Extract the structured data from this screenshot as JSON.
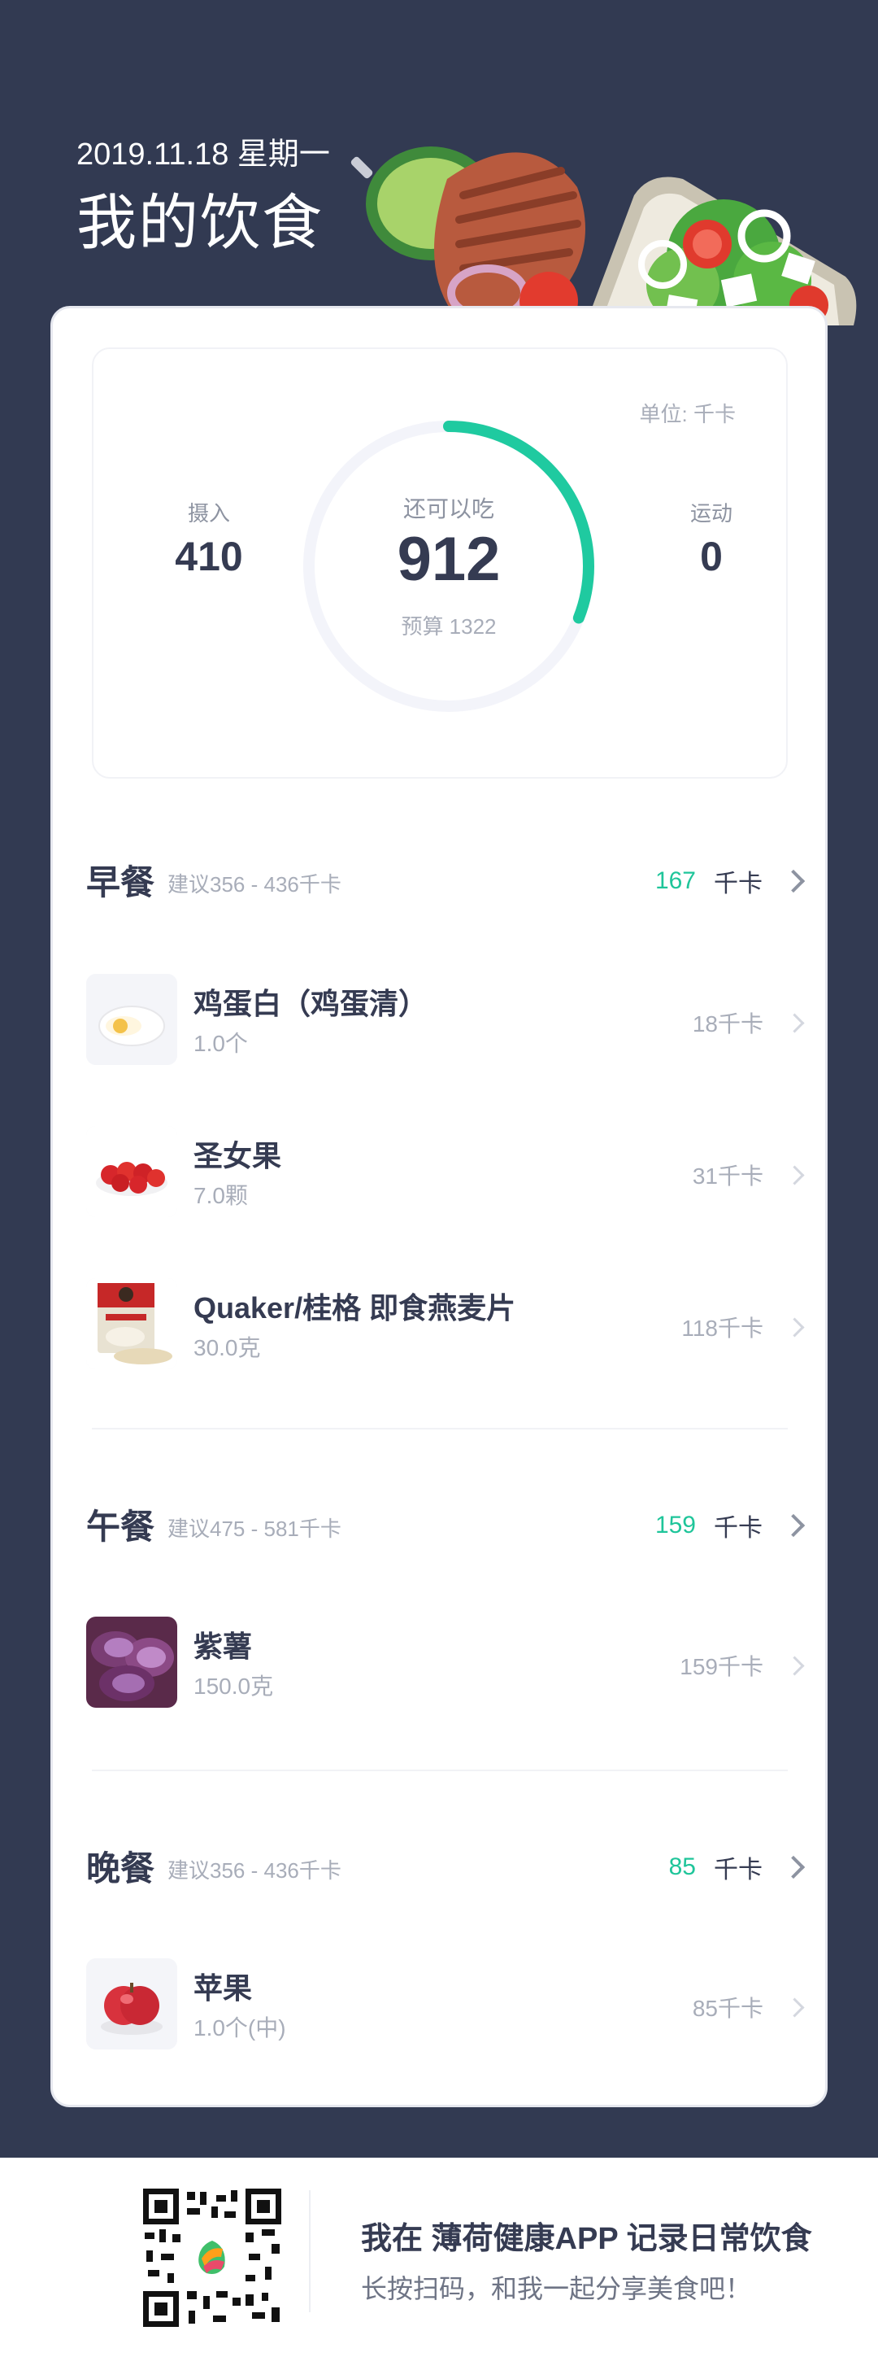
{
  "header": {
    "date": "2019.11.18 星期一",
    "title": "我的饮食"
  },
  "summary": {
    "unit": "单位: 千卡",
    "intake_label": "摄入",
    "intake_value": "410",
    "remaining_label": "还可以吃",
    "remaining_value": "912",
    "budget": "预算 1322",
    "exercise_label": "运动",
    "exercise_value": "0",
    "consumed_fraction": 0.31
  },
  "meals": [
    {
      "name": "早餐",
      "suggest": "建议356 - 436千卡",
      "kcal": "167",
      "unit": "千卡",
      "items": [
        {
          "name": "鸡蛋白（鸡蛋清）",
          "qty": "1.0个",
          "kcal": "18千卡",
          "icon": "egg-white-icon"
        },
        {
          "name": "圣女果",
          "qty": "7.0颗",
          "kcal": "31千卡",
          "icon": "cherry-tomato-icon"
        },
        {
          "name": "Quaker/桂格 即食燕麦片",
          "qty": "30.0克",
          "kcal": "118千卡",
          "icon": "oatmeal-package-icon"
        }
      ]
    },
    {
      "name": "午餐",
      "suggest": "建议475 - 581千卡",
      "kcal": "159",
      "unit": "千卡",
      "items": [
        {
          "name": "紫薯",
          "qty": "150.0克",
          "kcal": "159千卡",
          "icon": "purple-sweet-potato-icon"
        }
      ]
    },
    {
      "name": "晚餐",
      "suggest": "建议356 - 436千卡",
      "kcal": "85",
      "unit": "千卡",
      "items": [
        {
          "name": "苹果",
          "qty": "1.0个(中)",
          "kcal": "85千卡",
          "icon": "apple-icon"
        }
      ]
    }
  ],
  "footer": {
    "title": "我在 薄荷健康APP 记录日常饮食",
    "subtitle": "长按扫码，和我一起分享美食吧！"
  },
  "colors": {
    "background": "#323a52",
    "accent": "#1fc59a",
    "text": "#353b52"
  }
}
